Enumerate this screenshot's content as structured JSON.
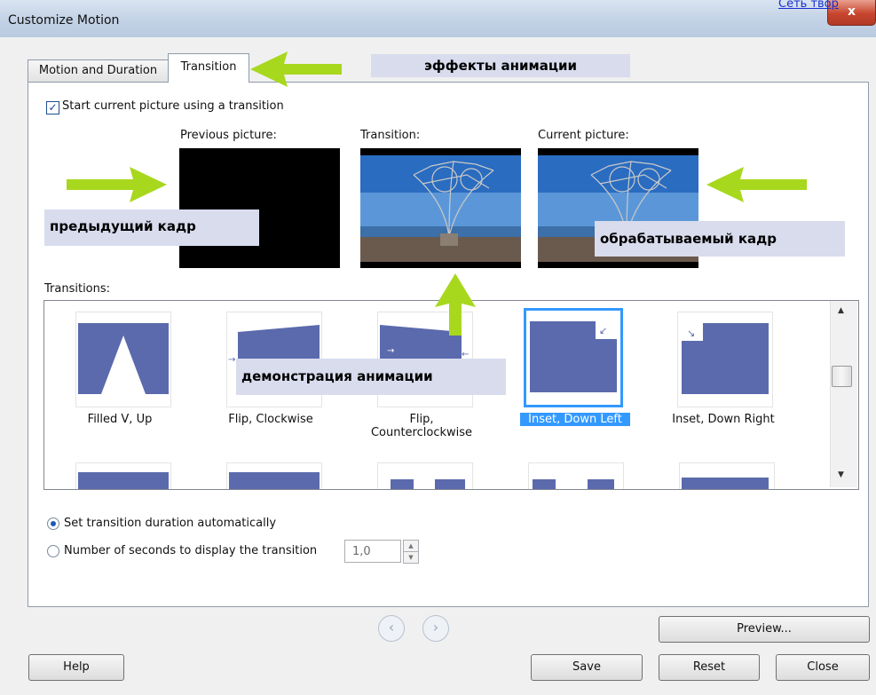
{
  "window": {
    "title": "Customize Motion",
    "close_glyph": "x",
    "top_link": "Сеть твор"
  },
  "tabs": [
    {
      "label": "Motion and Duration",
      "active": false
    },
    {
      "label": "Transition",
      "active": true
    }
  ],
  "checkbox": {
    "label": "Start current picture using a transition",
    "checked": true
  },
  "pictures": {
    "previous_label": "Previous picture:",
    "transition_label": "Transition:",
    "current_label": "Current picture:"
  },
  "annotations": {
    "effects": "эффекты анимации",
    "previous_frame": "предыдущий кадр",
    "current_frame": "обрабатываемый кадр",
    "demo": "демонстрация анимации"
  },
  "transitions": {
    "label": "Transitions:",
    "items": [
      {
        "label": "Filled V, Up",
        "selected": false,
        "icon": "filled-v-up-icon"
      },
      {
        "label": "Flip, Clockwise",
        "selected": false,
        "icon": "flip-clockwise-icon"
      },
      {
        "label": "Flip, Counterclockwise",
        "selected": false,
        "icon": "flip-counterclockwise-icon"
      },
      {
        "label": "Inset, Down Left",
        "selected": true,
        "icon": "inset-down-left-icon"
      },
      {
        "label": "Inset, Down Right",
        "selected": false,
        "icon": "inset-down-right-icon"
      }
    ]
  },
  "duration": {
    "auto_label": "Set transition duration automatically",
    "manual_label": "Number of seconds to display the transition",
    "seconds_value": "1,0",
    "auto_selected": true
  },
  "buttons": {
    "preview": "Preview...",
    "help": "Help",
    "save": "Save",
    "reset": "Reset",
    "close": "Close"
  },
  "colors": {
    "accent": "#3399ff",
    "thumb_fill": "#5b6aad",
    "arrow": "#a8d81e",
    "annotation_bg": "#d8dced"
  }
}
